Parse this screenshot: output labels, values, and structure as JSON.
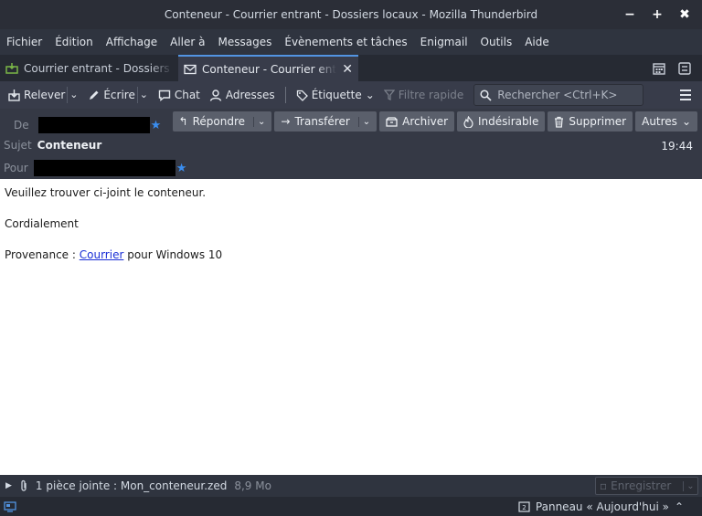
{
  "window": {
    "title": "Conteneur - Courrier entrant - Dossiers locaux - Mozilla Thunderbird",
    "minimize_glyph": "−",
    "maximize_glyph": "+",
    "close_glyph": "✖"
  },
  "menu": [
    "Fichier",
    "Édition",
    "Affichage",
    "Aller à",
    "Messages",
    "Évènements et tâches",
    "Enigmail",
    "Outils",
    "Aide"
  ],
  "tabs": [
    {
      "label": "Courrier entrant - Dossiers locaux",
      "icon": "inbox-icon"
    },
    {
      "label": "Conteneur - Courrier entrant",
      "icon": "envelope-icon",
      "close_glyph": "✕"
    }
  ],
  "toolbar": {
    "get_mail": "Relever",
    "write": "Écrire",
    "chat": "Chat",
    "address_book": "Adresses",
    "tag": "Étiquette",
    "quick_filter": "Filtre rapide",
    "search_placeholder": "Rechercher <Ctrl+K>"
  },
  "header": {
    "from_label": "De",
    "subject_label": "Sujet",
    "subject": "Conteneur",
    "to_label": "Pour",
    "time": "19:44",
    "actions": {
      "reply": "Répondre",
      "forward": "Transférer",
      "archive": "Archiver",
      "junk": "Indésirable",
      "delete": "Supprimer",
      "more": "Autres"
    }
  },
  "body": {
    "line1": "Veuillez trouver ci-joint le conteneur.",
    "line2": "Cordialement",
    "line3_prefix": "Provenance : ",
    "line3_link": "Courrier",
    "line3_suffix": " pour Windows 10"
  },
  "attachment": {
    "summary": "1 pièce jointe : Mon_conteneur.zed",
    "size": "8,9 Mo",
    "save": "Enregistrer"
  },
  "status": {
    "today_pane": "Panneau « Aujourd'hui »"
  },
  "colors": {
    "accent": "#5294e2",
    "star": "#3a8ef0",
    "link": "#1a2fd6"
  }
}
